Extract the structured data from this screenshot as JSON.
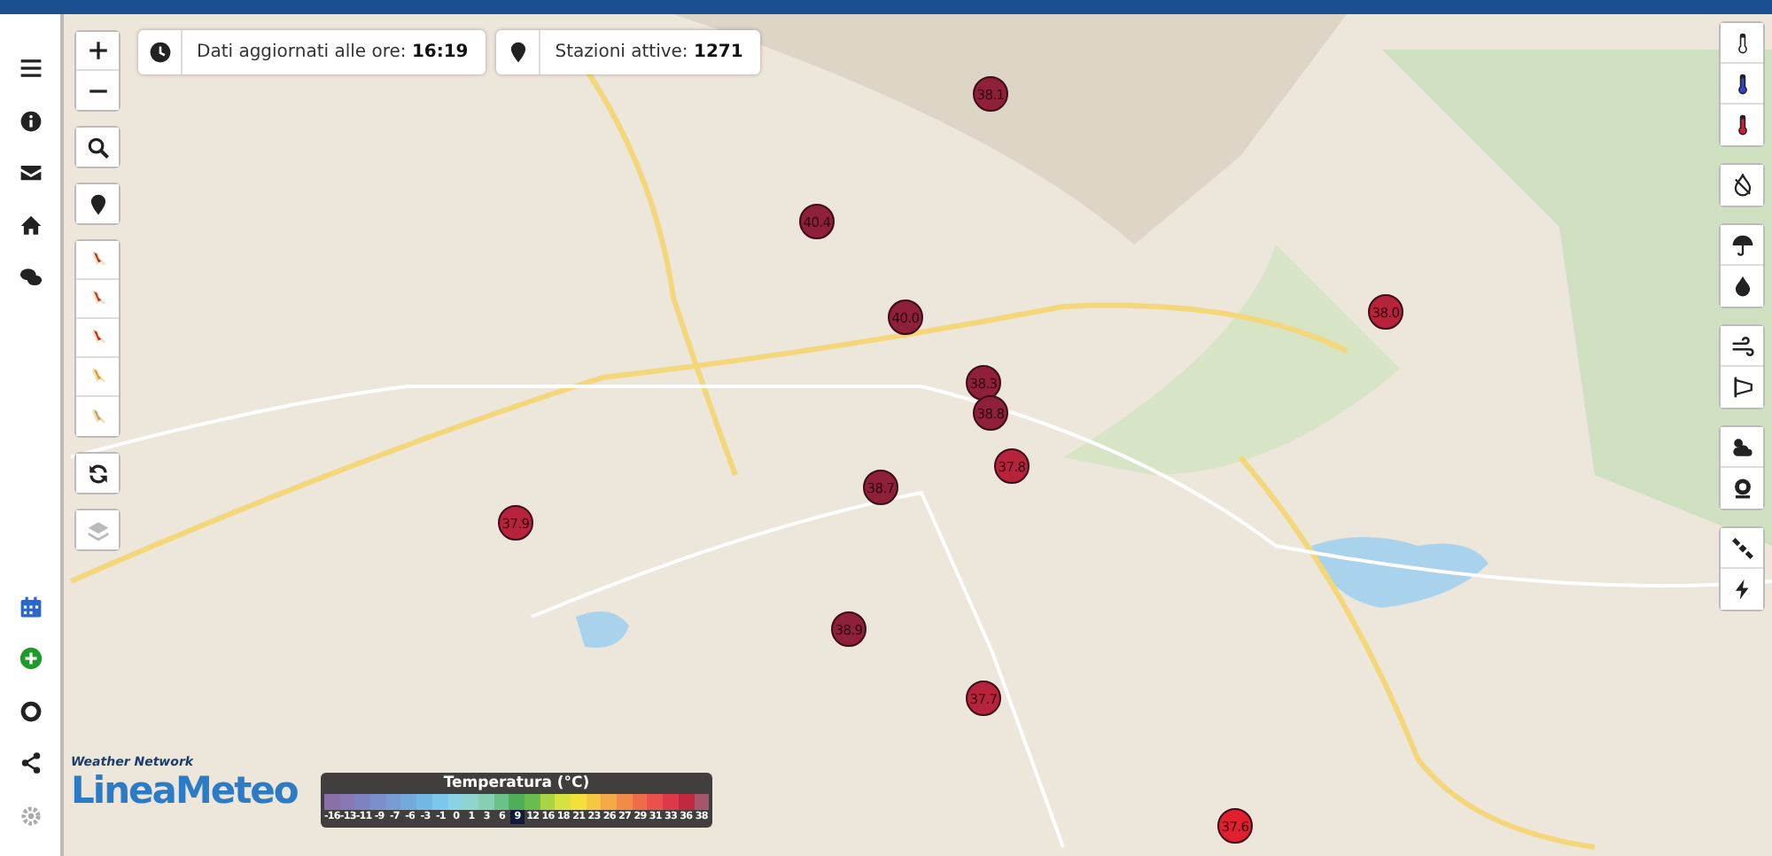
{
  "info_bar": [
    {
      "kind": "clock",
      "text": "Dati aggiornati alle ore: **16:19**"
    },
    {
      "kind": "pin",
      "text": "Stazioni attive: **1271**"
    }
  ],
  "stations": [
    {
      "value": "38.1",
      "color": "#8e2039"
    },
    {
      "value": "40.4",
      "color": "#8e2039"
    },
    {
      "value": "40.0",
      "color": "#8e2039"
    },
    {
      "value": "38.3",
      "color": "#8e2039"
    },
    {
      "value": "38.8",
      "color": "#8e2039"
    },
    {
      "value": "37.8",
      "color": "#b7233a"
    },
    {
      "value": "38.7",
      "color": "#8e2039"
    },
    {
      "value": "37.9",
      "color": "#b7233a"
    },
    {
      "value": "38.9",
      "color": "#8e2039"
    },
    {
      "value": "37.7",
      "color": "#b7233a"
    },
    {
      "value": "37.6",
      "color": "#e0202e"
    },
    {
      "value": "38.0",
      "color": "#b7233a"
    }
  ],
  "legend": {
    "title": "Temperatura (°C)",
    "steps": [
      {
        "label": "-16",
        "color": "#8a6fa8",
        "selected": false
      },
      {
        "label": "-13",
        "color": "#8a78b4",
        "selected": false
      },
      {
        "label": "-11",
        "color": "#7f82c0",
        "selected": false
      },
      {
        "label": "-9",
        "color": "#7a8fcc",
        "selected": false
      },
      {
        "label": "-7",
        "color": "#779cd6",
        "selected": false
      },
      {
        "label": "-6",
        "color": "#74a9de",
        "selected": false
      },
      {
        "label": "-3",
        "color": "#72b8e6",
        "selected": false
      },
      {
        "label": "-1",
        "color": "#7cc7ec",
        "selected": false
      },
      {
        "label": "0",
        "color": "#8ad2e6",
        "selected": false
      },
      {
        "label": "1",
        "color": "#8fd4cf",
        "selected": false
      },
      {
        "label": "3",
        "color": "#86cfb2",
        "selected": false
      },
      {
        "label": "6",
        "color": "#6cc08a",
        "selected": false
      },
      {
        "label": "9",
        "color": "#4fae5a",
        "selected": true
      },
      {
        "label": "12",
        "color": "#69bd4c",
        "selected": false
      },
      {
        "label": "16",
        "color": "#a9d443",
        "selected": false
      },
      {
        "label": "18",
        "color": "#d8e23f",
        "selected": false
      },
      {
        "label": "21",
        "color": "#f2e13c",
        "selected": false
      },
      {
        "label": "23",
        "color": "#f5c842",
        "selected": false
      },
      {
        "label": "26",
        "color": "#f4a948",
        "selected": false
      },
      {
        "label": "27",
        "color": "#f28a48",
        "selected": false
      },
      {
        "label": "29",
        "color": "#ee6c47",
        "selected": false
      },
      {
        "label": "31",
        "color": "#e9514a",
        "selected": false
      },
      {
        "label": "33",
        "color": "#dd3a48",
        "selected": false
      },
      {
        "label": "36",
        "color": "#c2283e",
        "selected": false
      },
      {
        "label": "38",
        "color": "#a6566a",
        "selected": false
      }
    ]
  },
  "logo": {
    "tagline": "Weather Network",
    "name": "LineaMeteo"
  }
}
